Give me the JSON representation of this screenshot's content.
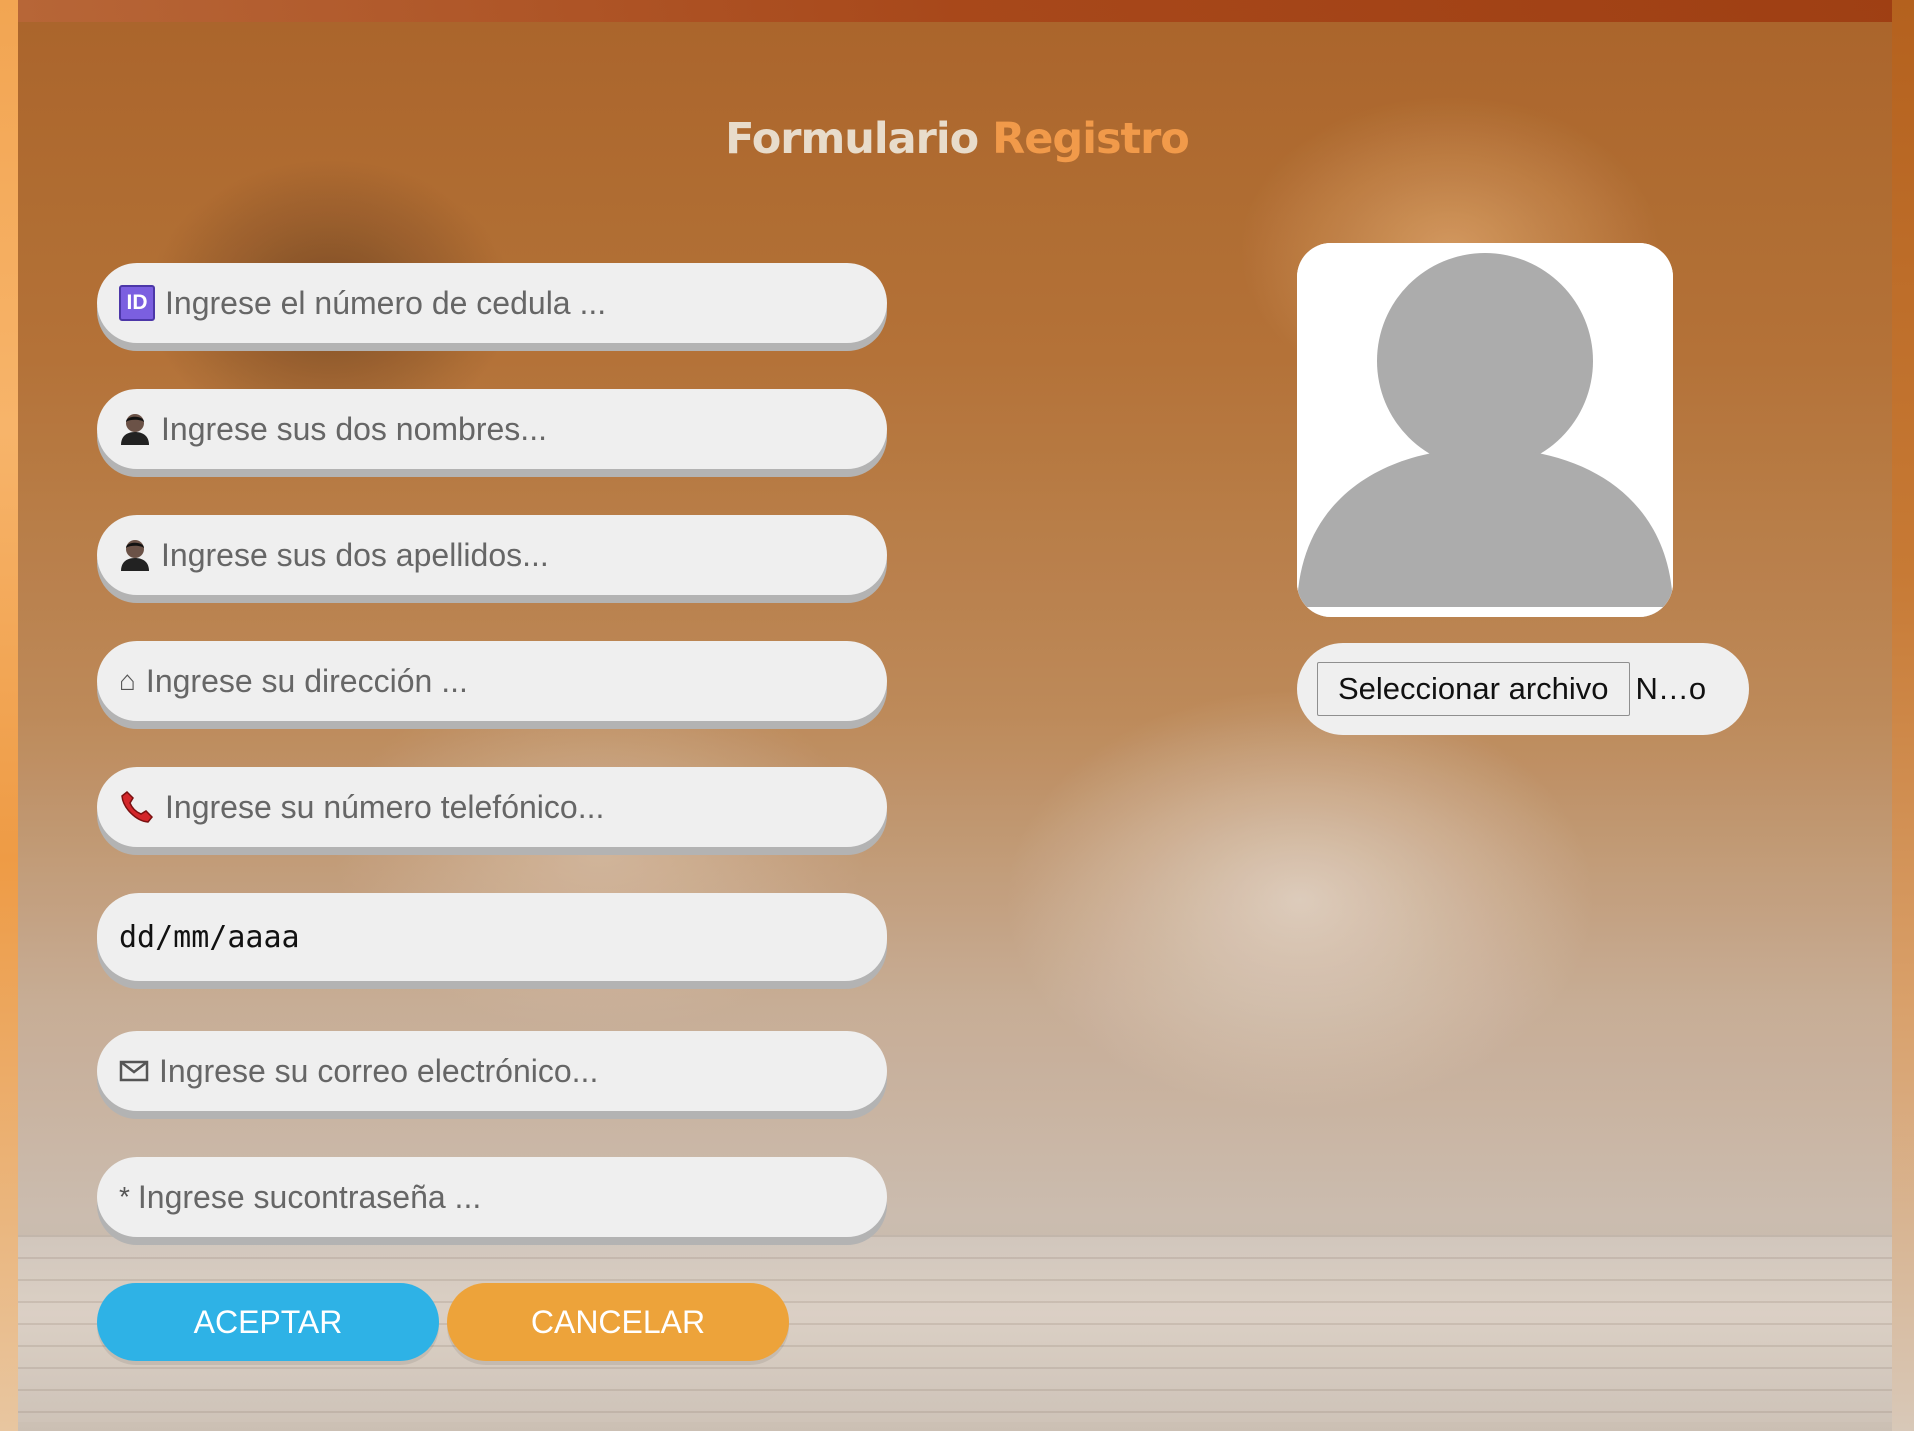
{
  "title": {
    "part1": "Formulario",
    "part2": "Registro"
  },
  "fields": [
    {
      "icon": "id-icon",
      "placeholder": "Ingrese el número de cedula ..."
    },
    {
      "icon": "person-icon",
      "placeholder": "Ingrese sus dos nombres..."
    },
    {
      "icon": "person-icon",
      "placeholder": "Ingrese sus dos apellidos..."
    },
    {
      "icon": "home-icon",
      "placeholder": "Ingrese su dirección ..."
    },
    {
      "icon": "phone-icon",
      "placeholder": "Ingrese su número telefónico..."
    },
    {
      "icon": "",
      "placeholder": "dd/mm/aaaa"
    },
    {
      "icon": "envelope-icon",
      "placeholder": "Ingrese su correo electrónico..."
    },
    {
      "icon": "asterisk-icon",
      "placeholder": "Ingrese sucontraseña ..."
    }
  ],
  "icons": {
    "id_label": "ID",
    "home_glyph": "⌂",
    "star_glyph": "*"
  },
  "buttons": {
    "accept": "ACEPTAR",
    "cancel": "CANCELAR"
  },
  "file_input": {
    "button_label": "Seleccionar archivo",
    "status": "N…o"
  },
  "colors": {
    "title_primary": "#e8dccb",
    "title_accent": "#f19a4a",
    "accept": "#2eb2e6",
    "cancel": "#eda33a",
    "field_bg": "#efefef",
    "avatar_gray": "#acacac"
  }
}
